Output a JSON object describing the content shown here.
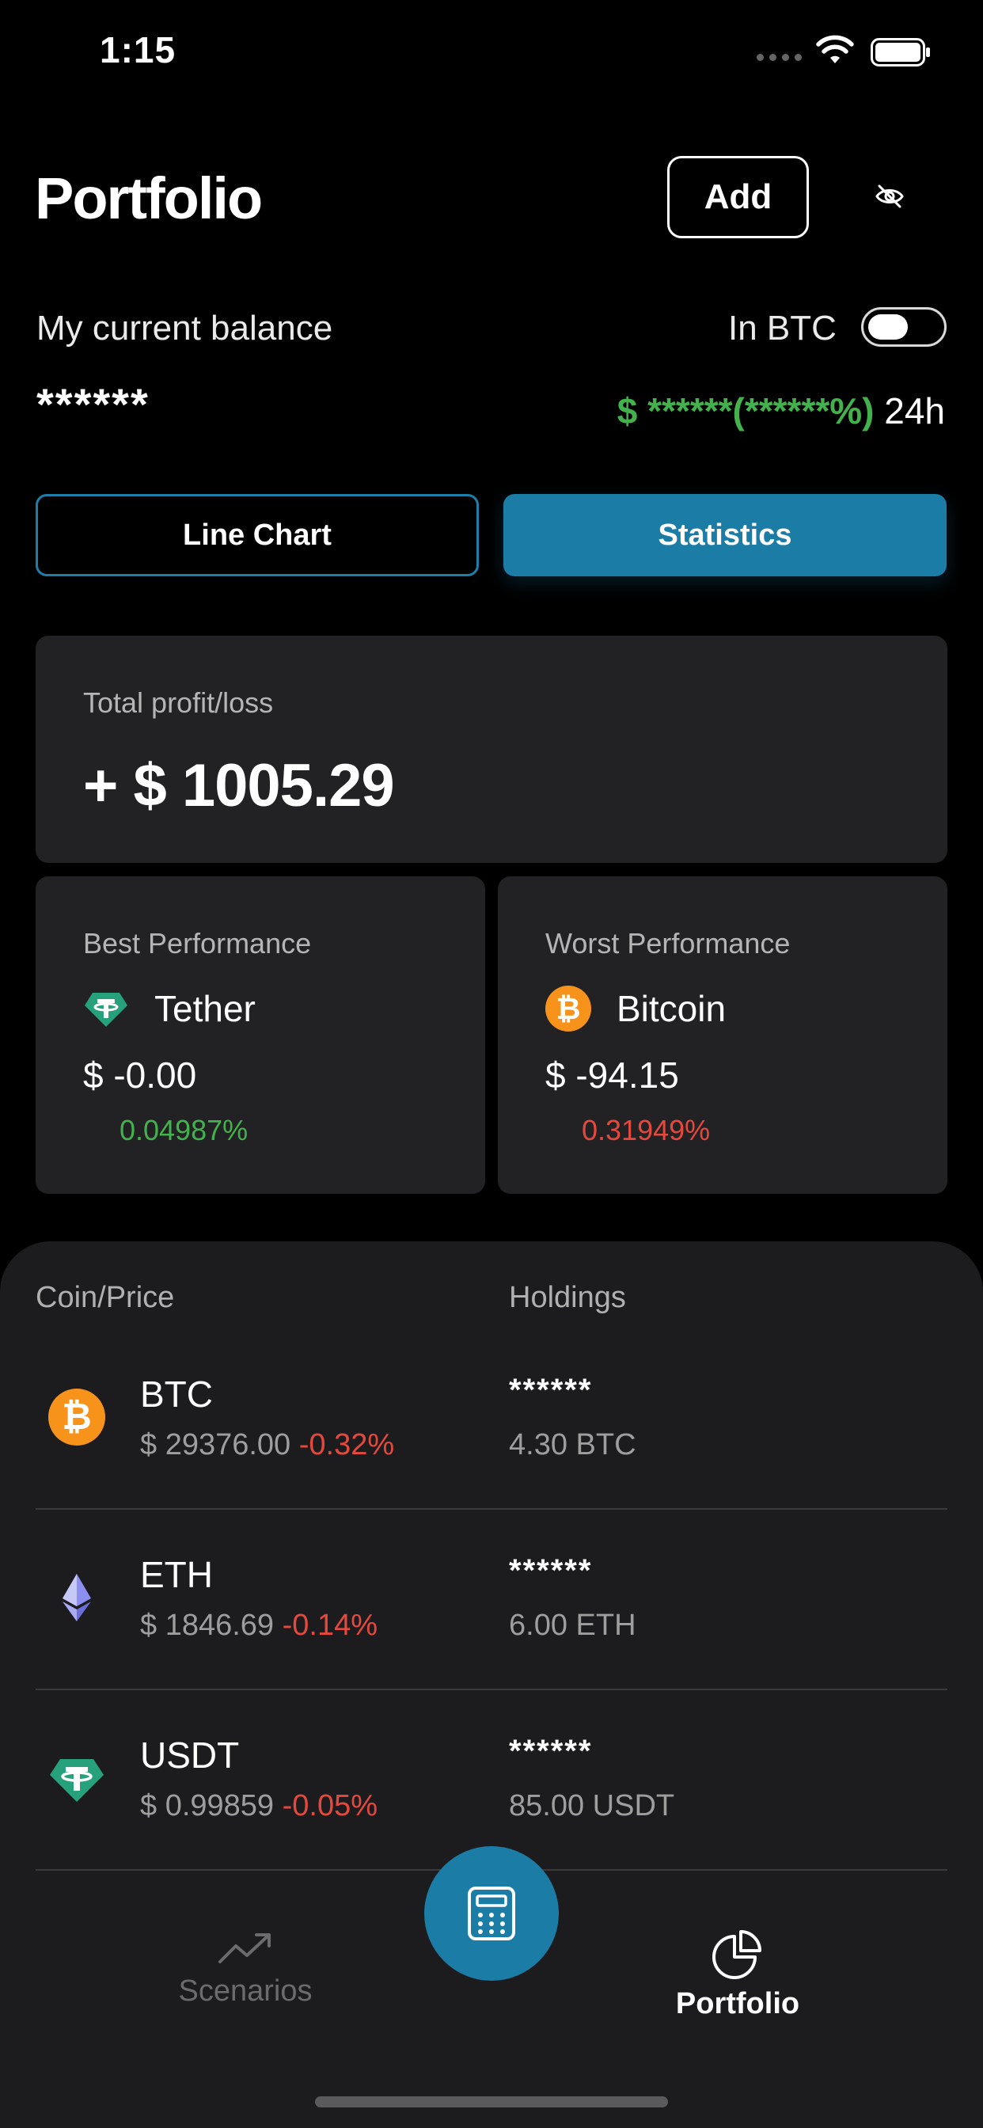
{
  "status_bar": {
    "time": "1:15"
  },
  "header": {
    "title": "Portfolio",
    "add_label": "Add"
  },
  "balance": {
    "label": "My current balance",
    "value": "******",
    "currency_toggle_label": "In BTC",
    "currency_toggle_on": false,
    "change_text": "$ ******(******%)",
    "change_period": "24h"
  },
  "view_tabs": {
    "line_chart": "Line Chart",
    "statistics": "Statistics",
    "selected": "Statistics"
  },
  "total": {
    "label": "Total profit/loss",
    "value": "+ $ 1005.29"
  },
  "best": {
    "label": "Best Performance",
    "coin": "Tether",
    "value": "$ -0.00",
    "pct": "0.04987%"
  },
  "worst": {
    "label": "Worst Performance",
    "coin": "Bitcoin",
    "value": "$ -94.15",
    "pct": "0.31949%"
  },
  "holdings": {
    "col_coin": "Coin/Price",
    "col_holdings": "Holdings",
    "rows": [
      {
        "symbol": "BTC",
        "price": "$ 29376.00",
        "change": "-0.32%",
        "amount": "******",
        "qty": "4.30 BTC"
      },
      {
        "symbol": "ETH",
        "price": "$ 1846.69",
        "change": "-0.14%",
        "amount": "******",
        "qty": "6.00 ETH"
      },
      {
        "symbol": "USDT",
        "price": "$ 0.99859",
        "change": "-0.05%",
        "amount": "******",
        "qty": "85.00 USDT"
      }
    ]
  },
  "nav": {
    "scenarios": "Scenarios",
    "portfolio": "Portfolio",
    "active": "Portfolio"
  },
  "colors": {
    "accent": "#1b7ca6",
    "positive": "#43b24d",
    "negative": "#e5493e",
    "bitcoin": "#f7931a",
    "tether": "#26a17b",
    "ethereum": "#627eea"
  }
}
